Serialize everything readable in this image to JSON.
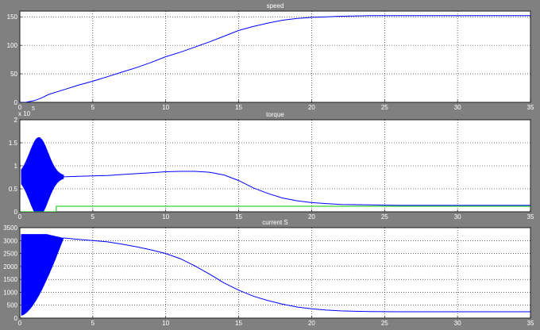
{
  "colors": {
    "background": "#808080",
    "axes": "#ffffff",
    "series_blue": "#0000ff",
    "series_green": "#00c800"
  },
  "chart_data": [
    {
      "type": "line",
      "title": "speed",
      "xlim": [
        0,
        35
      ],
      "ylim": [
        0,
        160
      ],
      "xticks": [
        "0",
        "5",
        "10",
        "15",
        "20",
        "25",
        "30",
        "35"
      ],
      "yticks": [
        0,
        50,
        100,
        150
      ],
      "ytick_labels": [
        "0",
        "50",
        "100",
        "150"
      ],
      "exponent_label": "",
      "grid": true,
      "series": [
        {
          "color": "#0000ff",
          "x": [
            0,
            0.3,
            0.6,
            1,
            1.5,
            2,
            3,
            4,
            5,
            6,
            7,
            8,
            9,
            10,
            11,
            12,
            13,
            14,
            15,
            16,
            17,
            18,
            19,
            20,
            21,
            22,
            24,
            26,
            28,
            30,
            32,
            35
          ],
          "y": [
            0,
            -0.5,
            1,
            3,
            8,
            14,
            22,
            30,
            37,
            45,
            53,
            61,
            70,
            80,
            88,
            97,
            106,
            116,
            126,
            133,
            139,
            144,
            147,
            149,
            150,
            151,
            152,
            152,
            152,
            152,
            152,
            152
          ]
        }
      ]
    },
    {
      "type": "line",
      "title": "torque",
      "xlim": [
        0,
        35
      ],
      "ylim": [
        0,
        2
      ],
      "xticks": [
        "0",
        "5",
        "10",
        "15",
        "20",
        "25",
        "30",
        "35"
      ],
      "yticks": [
        0,
        0.5,
        1,
        1.5,
        2
      ],
      "ytick_labels": [
        "0",
        "0.5",
        "1",
        "1.5",
        "2"
      ],
      "exponent_label": "5",
      "exponent_prefix": "x 10",
      "grid": true,
      "series": [
        {
          "color": "#0000ff",
          "x": [
            3,
            4,
            5,
            6,
            7,
            8,
            9,
            10,
            11,
            12,
            13,
            14,
            15,
            16,
            17,
            18,
            19,
            20,
            21,
            22,
            23,
            24,
            25,
            26,
            28,
            30,
            32,
            35
          ],
          "y": [
            0.76,
            0.77,
            0.78,
            0.79,
            0.81,
            0.83,
            0.85,
            0.87,
            0.88,
            0.88,
            0.86,
            0.8,
            0.68,
            0.52,
            0.4,
            0.3,
            0.24,
            0.2,
            0.18,
            0.16,
            0.155,
            0.15,
            0.145,
            0.14,
            0.14,
            0.14,
            0.14,
            0.14
          ]
        },
        {
          "color": "#00c800",
          "x": [
            0,
            2.5,
            2.5,
            35
          ],
          "y": [
            0,
            0,
            0.12,
            0.12
          ]
        }
      ],
      "oscillation": {
        "x_start": 0.1,
        "x_end": 3,
        "center": 0.76,
        "peak_amplitude": 0.84,
        "peak_x": 1.3
      }
    },
    {
      "type": "line",
      "title": "current S",
      "xlim": [
        0,
        35
      ],
      "ylim": [
        0,
        3500
      ],
      "xticks": [
        "0",
        "5",
        "10",
        "15",
        "20",
        "25",
        "30",
        "35"
      ],
      "yticks": [
        0,
        500,
        1000,
        1500,
        2000,
        2500,
        3000,
        3500
      ],
      "ytick_labels": [
        "0",
        "500",
        "1000",
        "1500",
        "2000",
        "2500",
        "3000",
        "3500"
      ],
      "exponent_label": "",
      "grid": true,
      "series": [
        {
          "color": "#0000ff",
          "x": [
            3,
            4,
            5,
            6,
            7,
            8,
            9,
            10,
            11,
            12,
            13,
            14,
            15,
            16,
            17,
            18,
            19,
            20,
            21,
            22,
            23,
            24,
            25,
            26,
            28,
            30,
            32,
            35
          ],
          "y": [
            3100,
            3050,
            3000,
            2950,
            2860,
            2760,
            2640,
            2500,
            2300,
            2020,
            1700,
            1360,
            1080,
            850,
            680,
            540,
            430,
            360,
            310,
            280,
            265,
            255,
            250,
            245,
            245,
            245,
            245,
            245
          ]
        }
      ],
      "oscillation": {
        "x_start": 0.1,
        "x_end": 3,
        "low_start": 100,
        "high": 3250,
        "settle": 3100
      }
    }
  ]
}
